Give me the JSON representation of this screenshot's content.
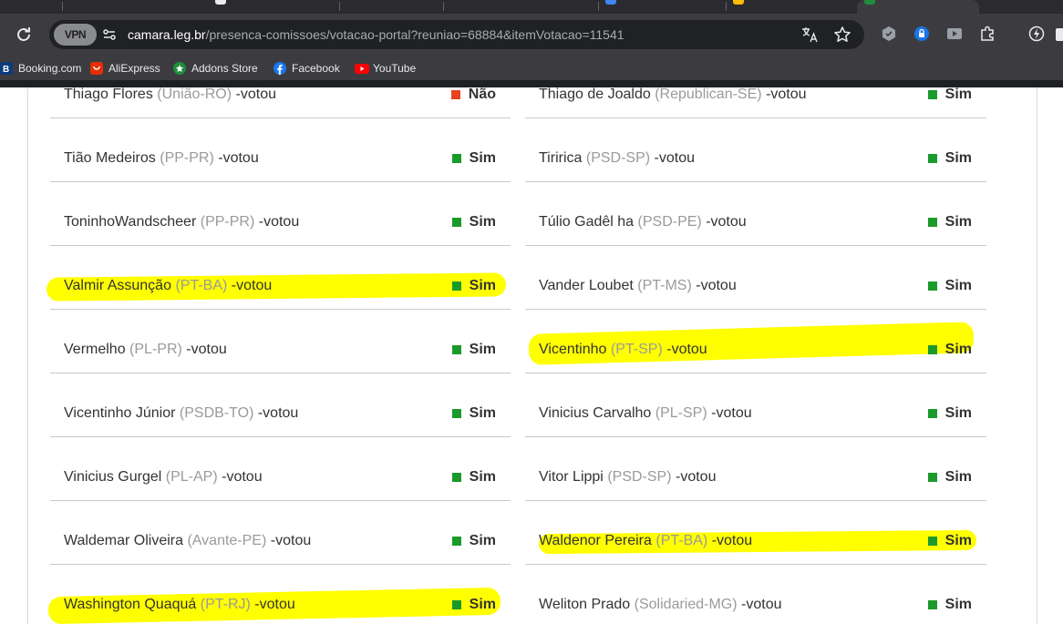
{
  "browser": {
    "vpn_label": "VPN",
    "url_host": "camara.leg.br",
    "url_path": "/presenca-comissoes/votacao-portal?reuniao=68884&itemVotacao=11541",
    "bookmarks": [
      {
        "label": "Booking.com",
        "icon": "booking-icon",
        "color": "#0c3b7c"
      },
      {
        "label": "AliExpress",
        "icon": "aliexpress-icon",
        "color": "#e62e04"
      },
      {
        "label": "Addons Store",
        "icon": "addons-store-icon",
        "color": "#1e8e3e"
      },
      {
        "label": "Facebook",
        "icon": "facebook-icon",
        "color": "#1877f2"
      },
      {
        "label": "YouTube",
        "icon": "youtube-icon",
        "color": "#ff0000"
      }
    ]
  },
  "colors": {
    "sim": "#1a9a2a",
    "nao": "#e8431f",
    "highlight": "#ffff00"
  },
  "votes_left": [
    {
      "name": "Thiago Flores",
      "party": "(União-RO)",
      "suffix": "-votou",
      "vote": "Não",
      "highlighted": false
    },
    {
      "name": "Tião Medeiros",
      "party": "(PP-PR)",
      "suffix": "-votou",
      "vote": "Sim",
      "highlighted": false
    },
    {
      "name": "ToninhoWandscheer",
      "party": "(PP-PR)",
      "suffix": "-votou",
      "vote": "Sim",
      "highlighted": false
    },
    {
      "name": "Valmir Assunção",
      "party": "(PT-BA)",
      "suffix": "-votou",
      "vote": "Sim",
      "highlighted": true
    },
    {
      "name": "Vermelho",
      "party": "(PL-PR)",
      "suffix": "-votou",
      "vote": "Sim",
      "highlighted": false
    },
    {
      "name": "Vicentinho Júnior",
      "party": "(PSDB-TO)",
      "suffix": "-votou",
      "vote": "Sim",
      "highlighted": false
    },
    {
      "name": "Vinicius Gurgel",
      "party": "(PL-AP)",
      "suffix": "-votou",
      "vote": "Sim",
      "highlighted": false
    },
    {
      "name": "Waldemar Oliveira",
      "party": "(Avante-PE)",
      "suffix": "-votou",
      "vote": "Sim",
      "highlighted": false
    },
    {
      "name": "Washington Quaquá",
      "party": "(PT-RJ)",
      "suffix": "-votou",
      "vote": "Sim",
      "highlighted": true
    }
  ],
  "votes_right": [
    {
      "name": "Thiago de Joaldo",
      "party": "(Republican-SE)",
      "suffix": "-votou",
      "vote": "Sim",
      "highlighted": false
    },
    {
      "name": "Tiririca",
      "party": "(PSD-SP)",
      "suffix": "-votou",
      "vote": "Sim",
      "highlighted": false
    },
    {
      "name": "Túlio Gadêl ha",
      "party": "(PSD-PE)",
      "suffix": "-votou",
      "vote": "Sim",
      "highlighted": false
    },
    {
      "name": "Vander Loubet",
      "party": "(PT-MS)",
      "suffix": "-votou",
      "vote": "Sim",
      "highlighted": false
    },
    {
      "name": "Vicentinho",
      "party": "(PT-SP)",
      "suffix": "-votou",
      "vote": "Sim",
      "highlighted": true
    },
    {
      "name": "Vinicius Carvalho",
      "party": "(PL-SP)",
      "suffix": "-votou",
      "vote": "Sim",
      "highlighted": false
    },
    {
      "name": "Vitor Lippi",
      "party": "(PSD-SP)",
      "suffix": "-votou",
      "vote": "Sim",
      "highlighted": false
    },
    {
      "name": "Waldenor Pereira",
      "party": "(PT-BA)",
      "suffix": "-votou",
      "vote": "Sim",
      "highlighted": true
    },
    {
      "name": "Weliton Prado",
      "party": "(Solidaried-MG)",
      "suffix": "-votou",
      "vote": "Sim",
      "highlighted": false
    }
  ]
}
